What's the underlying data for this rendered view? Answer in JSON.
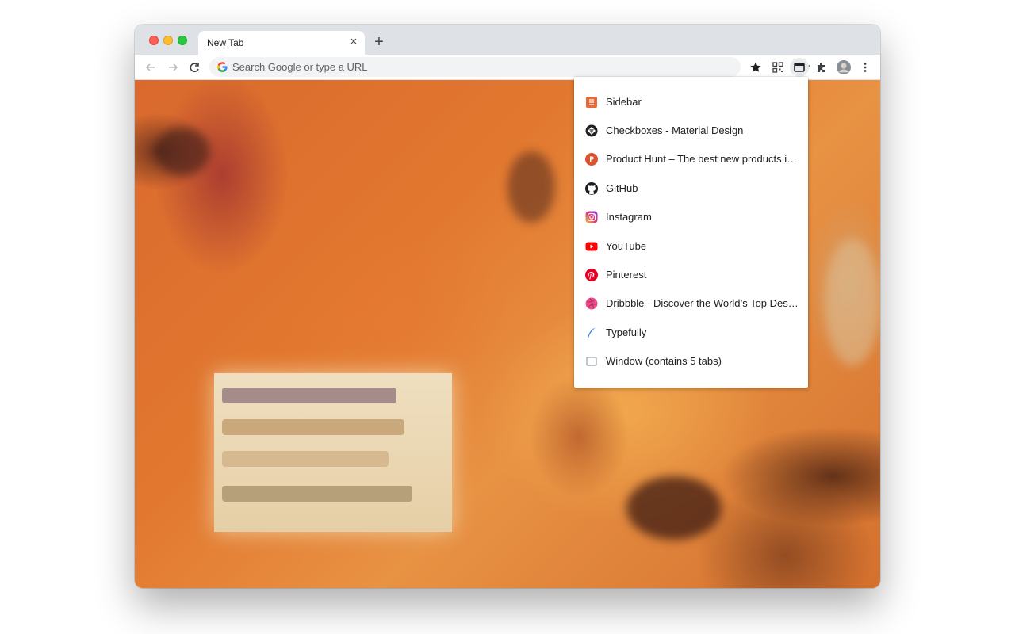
{
  "tab": {
    "title": "New Tab",
    "close_glyph": "×",
    "new_tab_glyph": "+"
  },
  "omnibox": {
    "placeholder": "Search Google or type a URL"
  },
  "toolbar": {
    "icons": [
      "back-arrow-icon",
      "forward-arrow-icon",
      "reload-icon",
      "google-g-icon",
      "bookmark-star-icon",
      "bookmarks-icon",
      "qr-code-icon",
      "tab-list-icon",
      "extensions-icon",
      "profile-avatar",
      "more-menu-icon"
    ]
  },
  "menu": {
    "items": [
      {
        "label": "Sidebar",
        "icon": "sidebar-icon",
        "color": "#e8683b"
      },
      {
        "label": "Checkboxes - Material Design",
        "icon": "material-design-icon",
        "color": "#212121"
      },
      {
        "label": "Product Hunt – The best new products in tech.",
        "icon": "product-hunt-icon",
        "color": "#da552f"
      },
      {
        "label": "GitHub",
        "icon": "github-icon",
        "color": "#1b1f23"
      },
      {
        "label": "Instagram",
        "icon": "instagram-icon",
        "color": "#d6249f"
      },
      {
        "label": "YouTube",
        "icon": "youtube-icon",
        "color": "#ff0000"
      },
      {
        "label": "Pinterest",
        "icon": "pinterest-icon",
        "color": "#e60023"
      },
      {
        "label": "Dribbble - Discover the World’s Top Designers & Creative Professionals",
        "icon": "dribbble-icon",
        "color": "#ea4c89"
      },
      {
        "label": "Typefully",
        "icon": "typefully-icon",
        "color": "#2f7de1"
      },
      {
        "label": "Window (contains 5 tabs)",
        "icon": "window-icon",
        "color": "#5f6368"
      }
    ]
  },
  "colors": {
    "titlebar": "#dee1e6",
    "omnibox": "#f1f3f4",
    "accent_active": "#e8eaed"
  }
}
